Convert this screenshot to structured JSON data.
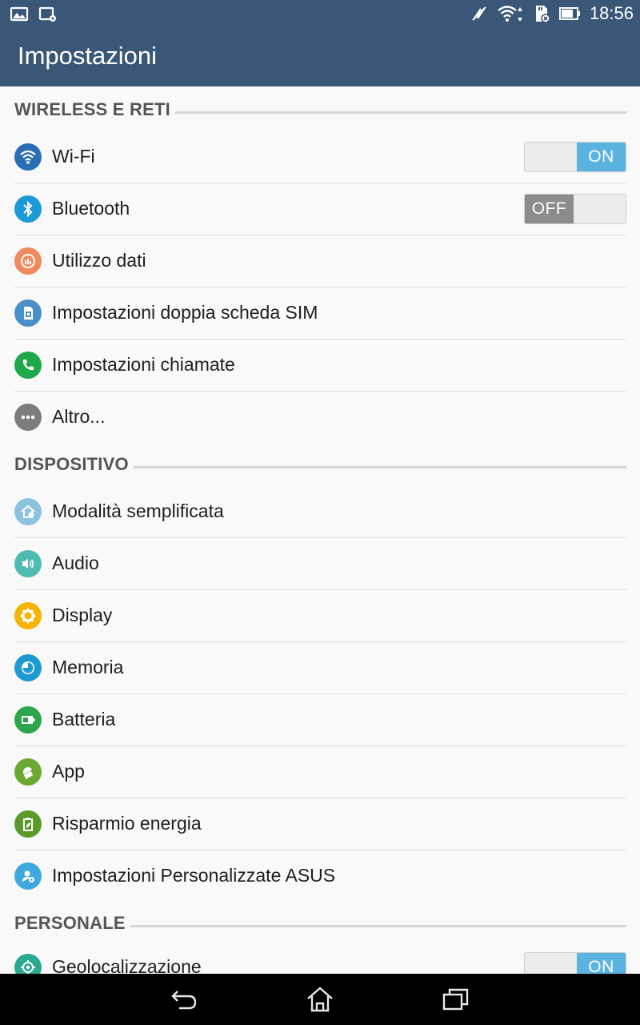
{
  "status_bar": {
    "time": "18:56",
    "left_icons": [
      "gallery-notification-icon",
      "screen-settings-notification-icon"
    ],
    "right_icons": [
      "vibrate-mute-icon",
      "wifi-signal-icon",
      "sd-card-icon",
      "battery-icon"
    ]
  },
  "action_bar": {
    "title": "Impostazioni"
  },
  "sections": {
    "wireless": {
      "header": "WIRELESS E RETI",
      "items": [
        {
          "label": "Wi-Fi",
          "icon": "wifi-icon",
          "color": "#2a6fb5",
          "toggle": "ON"
        },
        {
          "label": "Bluetooth",
          "icon": "bluetooth-icon",
          "color": "#1c9ad6",
          "toggle": "OFF"
        },
        {
          "label": "Utilizzo dati",
          "icon": "data-usage-icon",
          "color": "#ef8a5f"
        },
        {
          "label": "Impostazioni doppia scheda SIM",
          "icon": "sim-card-icon",
          "color": "#4a90c8"
        },
        {
          "label": "Impostazioni chiamate",
          "icon": "phone-icon",
          "color": "#1fa84a"
        },
        {
          "label": "Altro...",
          "icon": "more-icon",
          "color": "#7d7d7d"
        }
      ]
    },
    "device": {
      "header": "DISPOSITIVO",
      "items": [
        {
          "label": "Modalità semplificata",
          "icon": "easy-mode-home-icon",
          "color": "#8cc4e0"
        },
        {
          "label": "Audio",
          "icon": "speaker-icon",
          "color": "#4fbcb3"
        },
        {
          "label": "Display",
          "icon": "brightness-icon",
          "color": "#f5b400"
        },
        {
          "label": "Memoria",
          "icon": "storage-pie-icon",
          "color": "#1d9bd0"
        },
        {
          "label": "Batteria",
          "icon": "battery-icon",
          "color": "#2ca64a"
        },
        {
          "label": "App",
          "icon": "android-app-icon",
          "color": "#6aa832"
        },
        {
          "label": "Risparmio energia",
          "icon": "power-saver-leaf-icon",
          "color": "#5a9a2a"
        },
        {
          "label": "Impostazioni Personalizzate ASUS",
          "icon": "asus-custom-settings-icon",
          "color": "#3ea9de"
        }
      ]
    },
    "personal": {
      "header": "PERSONALE",
      "items": [
        {
          "label": "Geolocalizzazione",
          "icon": "location-target-icon",
          "color": "#2ca890",
          "toggle": "ON"
        }
      ]
    }
  },
  "nav_bar": {
    "buttons": [
      "back-icon",
      "home-icon",
      "recent-apps-icon"
    ]
  }
}
